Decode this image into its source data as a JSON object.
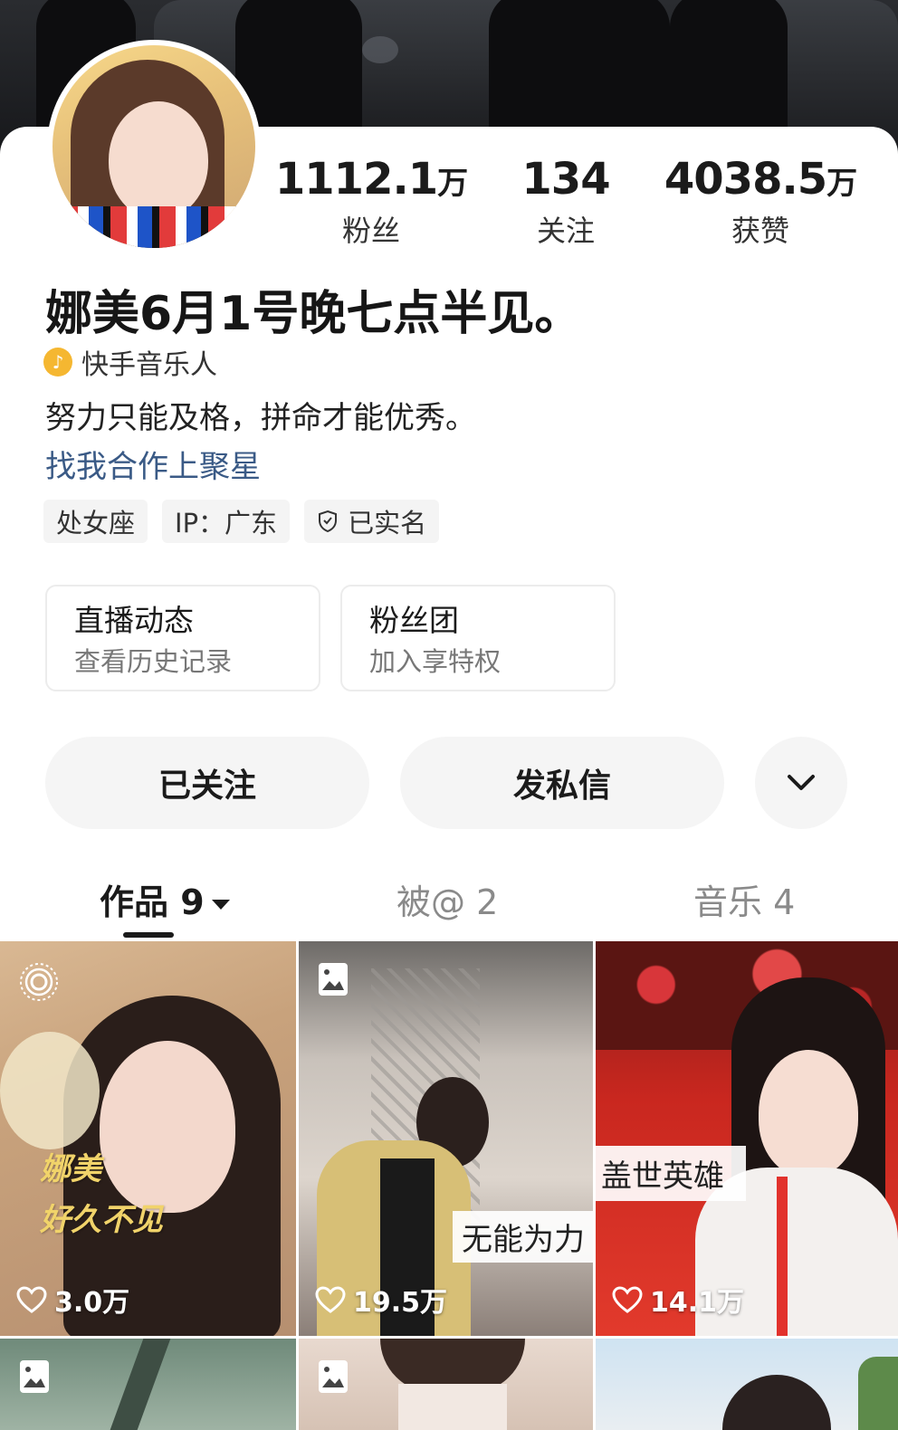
{
  "profile": {
    "stats": [
      {
        "value": "1112.1",
        "unit": "万",
        "label": "粉丝"
      },
      {
        "value": "134",
        "unit": "",
        "label": "关注"
      },
      {
        "value": "4038.5",
        "unit": "万",
        "label": "获赞"
      }
    ],
    "name": "娜美6月1号晚七点半见。",
    "badge": "快手音乐人",
    "bio": "努力只能及格，拼命才能优秀。",
    "link": "找我合作上聚星",
    "tags": [
      "处女座",
      "IP：广东",
      "已实名"
    ]
  },
  "info_cards": [
    {
      "title": "直播动态",
      "subtitle": "查看历史记录"
    },
    {
      "title": "粉丝团",
      "subtitle": "加入享特权"
    }
  ],
  "actions": {
    "follow_label": "已关注",
    "message_label": "发私信",
    "more_icon": "chevron-down-icon"
  },
  "tabs": [
    {
      "label": "作品 9",
      "active": true
    },
    {
      "label": "被@ 2",
      "active": false
    },
    {
      "label": "音乐 4",
      "active": false
    }
  ],
  "works": [
    {
      "likes": "3.0万",
      "overlay": "",
      "handwritten": [
        "娜美",
        "好久不见"
      ],
      "icon": "live-photo-icon"
    },
    {
      "likes": "19.5万",
      "overlay": "无能为力",
      "icon": "image-icon"
    },
    {
      "likes": "14.1万",
      "overlay": "盖世英雄",
      "icon": ""
    },
    {
      "likes": "",
      "overlay": "",
      "icon": "image-icon"
    },
    {
      "likes": "",
      "overlay": "",
      "icon": "image-icon"
    },
    {
      "likes": "",
      "overlay": "",
      "icon": ""
    }
  ]
}
